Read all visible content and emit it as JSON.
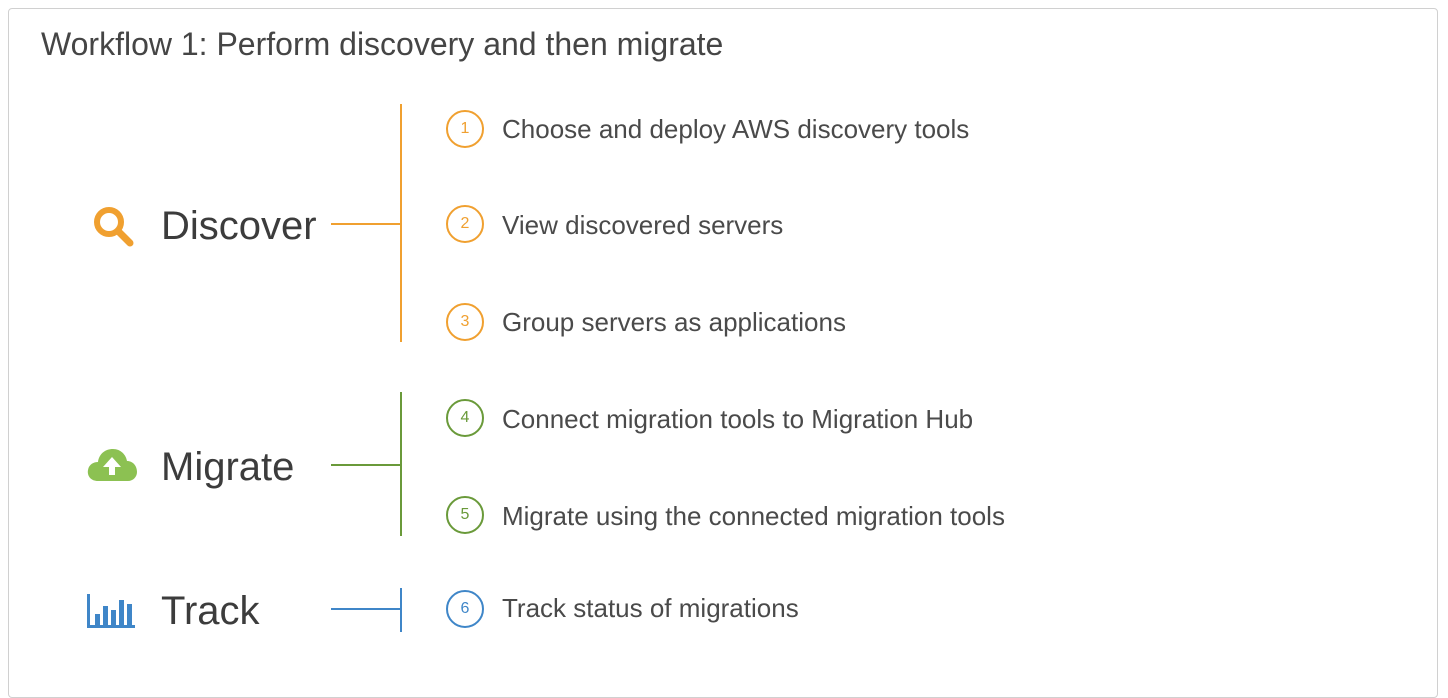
{
  "title": "Workflow 1: Perform discovery and then migrate",
  "colors": {
    "discover": "#f0a030",
    "migrate": "#6a9a3a",
    "migrate_icon": "#8cc152",
    "track": "#3f86c8"
  },
  "phases": [
    {
      "label": "Discover",
      "icon": "magnifier-icon",
      "steps": [
        {
          "number": "1",
          "text": "Choose and deploy AWS discovery tools"
        },
        {
          "number": "2",
          "text": "View discovered servers"
        },
        {
          "number": "3",
          "text": "Group servers as applications"
        }
      ]
    },
    {
      "label": "Migrate",
      "icon": "cloud-upload-icon",
      "steps": [
        {
          "number": "4",
          "text": "Connect migration tools to Migration Hub"
        },
        {
          "number": "5",
          "text": "Migrate using the connected migration tools"
        }
      ]
    },
    {
      "label": "Track",
      "icon": "bar-chart-icon",
      "steps": [
        {
          "number": "6",
          "text": "Track status of migrations"
        }
      ]
    }
  ]
}
